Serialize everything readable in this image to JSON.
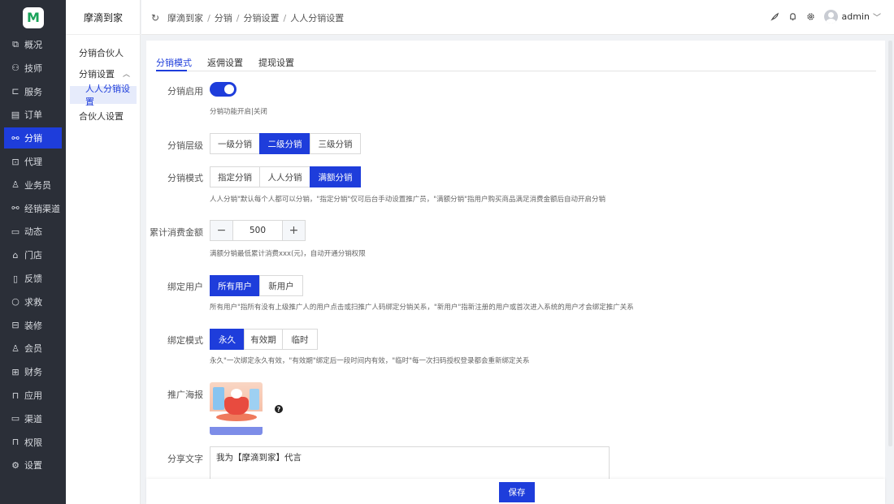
{
  "app": {
    "logo_letter": "M",
    "brand": "摩滴到家"
  },
  "rail": {
    "items": [
      {
        "label": "概况",
        "icon": "chart-icon"
      },
      {
        "label": "技师",
        "icon": "people-icon"
      },
      {
        "label": "服务",
        "icon": "bag-icon"
      },
      {
        "label": "订单",
        "icon": "order-icon"
      },
      {
        "label": "分销",
        "icon": "distribution-icon",
        "active": true
      },
      {
        "label": "代理",
        "icon": "agent-icon"
      },
      {
        "label": "业务员",
        "icon": "user-icon"
      },
      {
        "label": "经销渠道",
        "icon": "channel-icon"
      },
      {
        "label": "动态",
        "icon": "document-icon"
      },
      {
        "label": "门店",
        "icon": "store-icon"
      },
      {
        "label": "反馈",
        "icon": "book-icon"
      },
      {
        "label": "求救",
        "icon": "circle-icon"
      },
      {
        "label": "装修",
        "icon": "decor-icon"
      },
      {
        "label": "会员",
        "icon": "member-icon"
      },
      {
        "label": "财务",
        "icon": "finance-icon"
      },
      {
        "label": "应用",
        "icon": "app-icon"
      },
      {
        "label": "渠道",
        "icon": "monitor-icon"
      },
      {
        "label": "权限",
        "icon": "lock-icon"
      },
      {
        "label": "设置",
        "icon": "gear-icon"
      }
    ]
  },
  "subnav": {
    "items": [
      {
        "label": "分销合伙人"
      },
      {
        "label": "分销设置"
      },
      {
        "label": "人人分销设置",
        "active": true
      },
      {
        "label": "合伙人设置"
      }
    ]
  },
  "breadcrumb": {
    "items": [
      "摩滴到家",
      "分销",
      "分销设置",
      "人人分销设置"
    ],
    "separator": "/"
  },
  "user": {
    "name": "admin"
  },
  "tabs": [
    {
      "label": "分销模式",
      "active": true
    },
    {
      "label": "返佣设置"
    },
    {
      "label": "提现设置"
    }
  ],
  "form": {
    "enable": {
      "label": "分销启用",
      "value": true,
      "hint": "分销功能开启|关闭"
    },
    "level": {
      "label": "分销层级",
      "options": [
        "一级分销",
        "二级分销",
        "三级分销"
      ],
      "selected": "二级分销"
    },
    "mode": {
      "label": "分销模式",
      "options": [
        "指定分销",
        "人人分销",
        "满额分销"
      ],
      "selected": "满额分销",
      "hint": "人人分销\"默认每个人都可以分销，\"指定分销\"仅可后台手动设置推广员，\"满额分销\"指用户购买商品满足消费金额后自动开启分销"
    },
    "amount": {
      "label": "累计消费金额",
      "value": "500",
      "minus": "−",
      "plus": "+",
      "hint": "满额分销最低累计消费xxx(元)，自动开通分销权限"
    },
    "bind_user": {
      "label": "绑定用户",
      "options": [
        "所有用户",
        "新用户"
      ],
      "selected": "所有用户",
      "hint": "所有用户\"指所有没有上级推广人的用户点击或扫推广人码绑定分销关系，\"新用户\"指新注册的用户或首次进入系统的用户才会绑定推广关系"
    },
    "bind_mode": {
      "label": "绑定模式",
      "options": [
        "永久",
        "有效期",
        "临时"
      ],
      "selected": "永久",
      "hint": "永久\"一次绑定永久有效，\"有效期\"绑定后一段时间内有效，\"临时\"每一次扫码授权登录都会重新绑定关系"
    },
    "poster": {
      "label": "推广海报",
      "help": "?"
    },
    "share_text": {
      "label": "分享文字",
      "value": "我为【摩滴到家】代言"
    }
  },
  "footer": {
    "save_label": "保存"
  },
  "colors": {
    "accent": "#1e3ddb",
    "rail_bg": "#2b2f38"
  }
}
